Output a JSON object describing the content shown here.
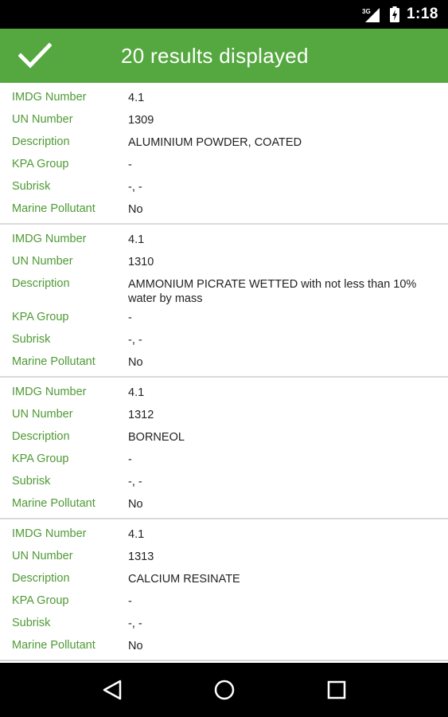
{
  "status_bar": {
    "network": "3G",
    "time": "1:18"
  },
  "app_bar": {
    "title": "20 results displayed",
    "confirm_icon": "checkmark-icon"
  },
  "colors": {
    "app_bar": "#55a83f",
    "label": "#4e9a34",
    "value": "#222222",
    "divider": "#dadada"
  },
  "results": [
    {
      "rows": [
        {
          "label": "IMDG Number",
          "value": "4.1"
        },
        {
          "label": "UN Number",
          "value": "1309"
        },
        {
          "label": "Description",
          "value": "ALUMINIUM POWDER, COATED"
        },
        {
          "label": "KPA Group",
          "value": "-"
        },
        {
          "label": "Subrisk",
          "value": "-, -"
        },
        {
          "label": "Marine Pollutant",
          "value": "No"
        }
      ]
    },
    {
      "rows": [
        {
          "label": "IMDG Number",
          "value": "4.1"
        },
        {
          "label": "UN Number",
          "value": "1310"
        },
        {
          "label": "Description",
          "value": "AMMONIUM PICRATE WETTED with not less than 10% water by mass"
        },
        {
          "label": "KPA Group",
          "value": "-"
        },
        {
          "label": "Subrisk",
          "value": "-, -"
        },
        {
          "label": "Marine Pollutant",
          "value": "No"
        }
      ]
    },
    {
      "rows": [
        {
          "label": "IMDG Number",
          "value": "4.1"
        },
        {
          "label": "UN Number",
          "value": "1312"
        },
        {
          "label": "Description",
          "value": "BORNEOL"
        },
        {
          "label": "KPA Group",
          "value": "-"
        },
        {
          "label": "Subrisk",
          "value": "-, -"
        },
        {
          "label": "Marine Pollutant",
          "value": "No"
        }
      ]
    },
    {
      "rows": [
        {
          "label": "IMDG Number",
          "value": "4.1"
        },
        {
          "label": "UN Number",
          "value": "1313"
        },
        {
          "label": "Description",
          "value": "CALCIUM RESINATE"
        },
        {
          "label": "KPA Group",
          "value": "-"
        },
        {
          "label": "Subrisk",
          "value": "-, -"
        },
        {
          "label": "Marine Pollutant",
          "value": "No"
        }
      ]
    }
  ],
  "nav_bar": {
    "back_icon": "back-icon",
    "home_icon": "home-icon",
    "recents_icon": "recents-icon"
  }
}
